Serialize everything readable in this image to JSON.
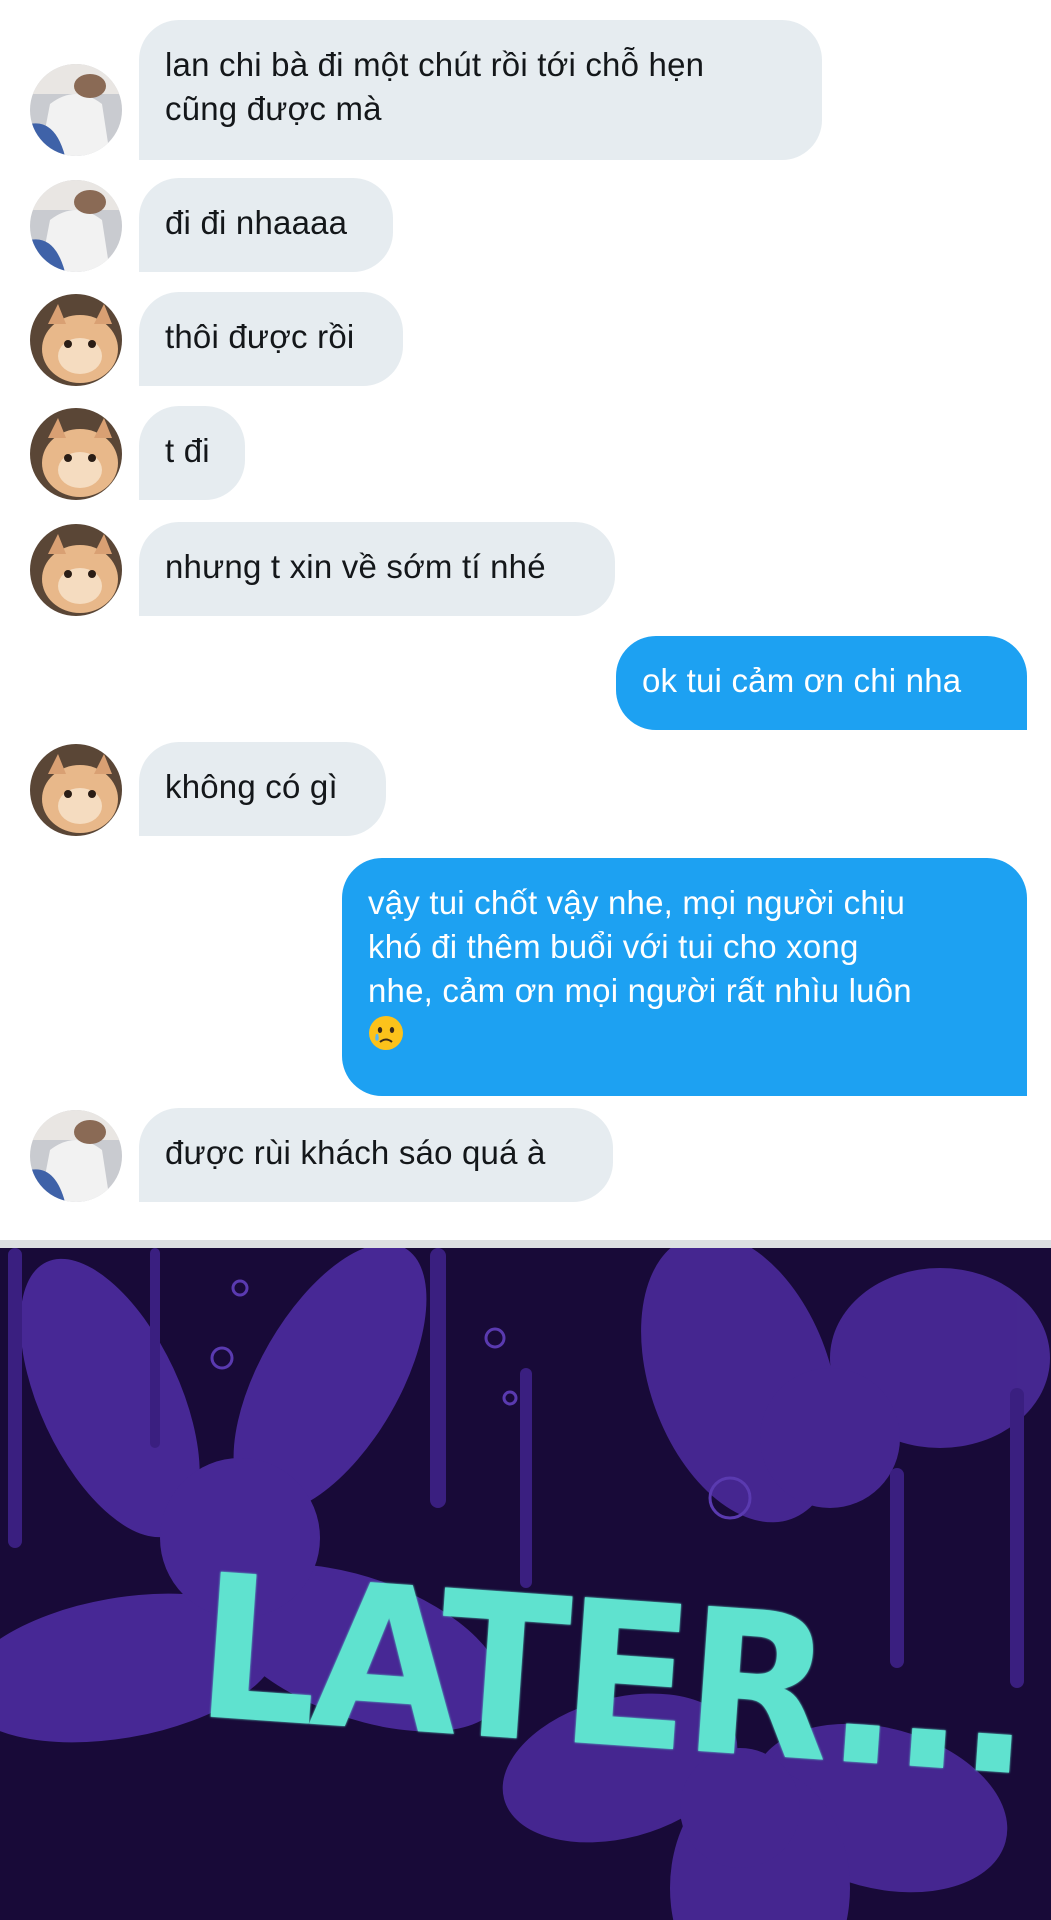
{
  "messages": [
    {
      "side": "in",
      "avatar": "girl-photo",
      "text_lines": [
        "lan chi bà đi một chút rồi tới chỗ hẹn",
        "cũng được mà"
      ]
    },
    {
      "side": "in",
      "avatar": "girl-photo",
      "text_lines": [
        "đi đi nhaaaa"
      ]
    },
    {
      "side": "in",
      "avatar": "cat-photo",
      "text_lines": [
        "thôi được rồi"
      ]
    },
    {
      "side": "in",
      "avatar": "cat-photo",
      "text_lines": [
        "t đi"
      ]
    },
    {
      "side": "in",
      "avatar": "cat-photo",
      "text_lines": [
        "nhưng t xin về sớm tí nhé"
      ]
    },
    {
      "side": "out",
      "text_lines": [
        "ok tui cảm ơn chi nha"
      ]
    },
    {
      "side": "in",
      "avatar": "cat-photo",
      "text_lines": [
        "không có gì"
      ]
    },
    {
      "side": "out",
      "text_lines": [
        "vậy tui chốt vậy nhe, mọi người chịu",
        "khó đi thêm buổi với tui cho xong",
        "nhe, cảm ơn mọi người rất nhìu luôn"
      ],
      "emoji": "crying-face"
    },
    {
      "side": "in",
      "avatar": "girl-photo",
      "text_lines": [
        "được rùi khách sáo quá à"
      ]
    }
  ],
  "banner": {
    "text": "LATER...",
    "text_color": "#5fe2cf",
    "background_color": "#180a38",
    "pattern_color": "#4a2a9a"
  },
  "colors": {
    "incoming_bubble": "#e6ecf0",
    "outgoing_bubble": "#1da1f2",
    "incoming_text": "#14171a",
    "outgoing_text": "#ffffff"
  }
}
